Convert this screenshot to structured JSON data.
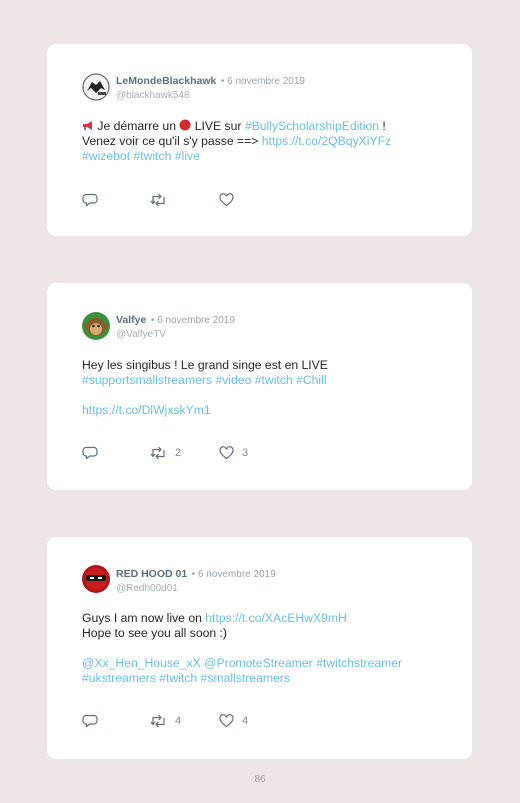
{
  "tweets": [
    {
      "name": "LeMondeBlackhawk",
      "date": "• 6 novembre 2019",
      "handle": "@blackhawk548",
      "line1_a": " Je démarre un ",
      "line1_b": " LIVE sur ",
      "line1_tag": "#BullyScholarshipEdition",
      "line1_c": " !",
      "line2_text": "Venez voir ce qu'il s'y passe ==> ",
      "line2_link": "https://t.co/2QBqyXiYFz",
      "line3_tag1": "#wizebot",
      "line3_tag2": "#twitch",
      "line3_tag3": "#live",
      "retweets": "",
      "likes": ""
    },
    {
      "name": "Valfye",
      "date": "• 6 novembre 2019",
      "handle": "@ValfyeTV",
      "line1": "Hey les singibus ! Le grand singe est en LIVE",
      "line2_tag1": "#supportsmallstreamers",
      "line2_tag2": "#video",
      "line2_tag3": "#twitch",
      "line2_tag4": "#Chill",
      "line4_link": "https://t.co/DlWjxskYm1",
      "retweets": "2",
      "likes": "3"
    },
    {
      "name": "RED HOOD 01",
      "date": "• 6 novembre 2019",
      "handle": "@Redh00d01",
      "line1_text": "Guys I am now live on ",
      "line1_link": "https://t.co/XAcEHwX9mH",
      "line2": "Hope to see you all soon :)",
      "line4_m1": "@Xx_Hen_House_xX",
      "line4_m2": "@PromoteStreamer",
      "line4_tag": "#twitchstreamer",
      "line5_tag1": "#ukstreamers",
      "line5_tag2": "#twitch",
      "line5_tag3": "#smallstreamers",
      "retweets": "4",
      "likes": "4"
    }
  ],
  "page_number": "86",
  "icons": {
    "reply": "reply-bubble-icon",
    "retweet": "retweet-icon",
    "like": "heart-icon",
    "megaphone": "megaphone-emoji",
    "red_circle": "red-circle-emoji"
  },
  "colors": {
    "link": "#6bbfe3",
    "name": "#5c6f80",
    "background": "#ede4e4"
  }
}
